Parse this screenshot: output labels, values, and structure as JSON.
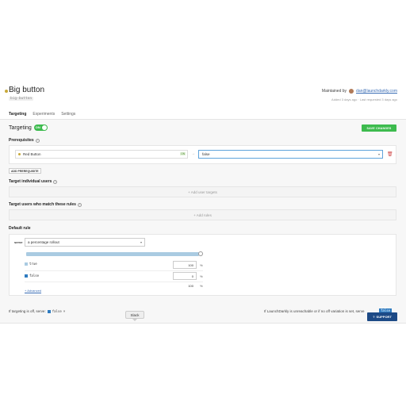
{
  "flag": {
    "title": "Big button",
    "key": "big-button",
    "maintained_by_label": "Maintained by",
    "maintainer_email": "dan@launchdarkly.com",
    "meta": "Added 3 days ago · Last requested 3 days ago"
  },
  "tabs": [
    {
      "label": "Targeting",
      "active": true
    },
    {
      "label": "Experiments",
      "active": false
    },
    {
      "label": "Settings",
      "active": false
    }
  ],
  "targeting": {
    "label": "Targeting",
    "toggle_label": "ON",
    "save_label": "SAVE CHANGES"
  },
  "prerequisites": {
    "label": "Prerequisites",
    "flag_name": "Red Button",
    "flag_badge": "ON",
    "variation": "false",
    "add_label": "ADD PREREQUISITE"
  },
  "individual": {
    "label": "Target individual users",
    "add_label": "+ Add user targets"
  },
  "rules": {
    "label": "Target users who match these rules",
    "add_label": "+ Add rules"
  },
  "default_rule": {
    "label": "Default rule",
    "serve_label": "serve",
    "serve_value": "a percentage rollout",
    "variations": [
      {
        "name": "true",
        "percent": "100",
        "color": "#aacbe2"
      },
      {
        "name": "false",
        "percent": "0",
        "color": "#2f7bc0"
      }
    ],
    "total": "100",
    "percent_sign": "%",
    "advanced_label": "+ Advanced"
  },
  "footer": {
    "off_serve_label": "If targeting is off, serve:",
    "off_serve_value": "false",
    "unreachable_label": "If LaunchDarkly is unreachable or if no off variation is set, serve",
    "unreachable_value": "false"
  },
  "widgets": {
    "slack_label": "Slack",
    "support_label": "SUPPORT"
  },
  "colors": {
    "accent_green": "#3dbb4e",
    "link_blue": "#3a6db5",
    "support_navy": "#1d4a86"
  }
}
